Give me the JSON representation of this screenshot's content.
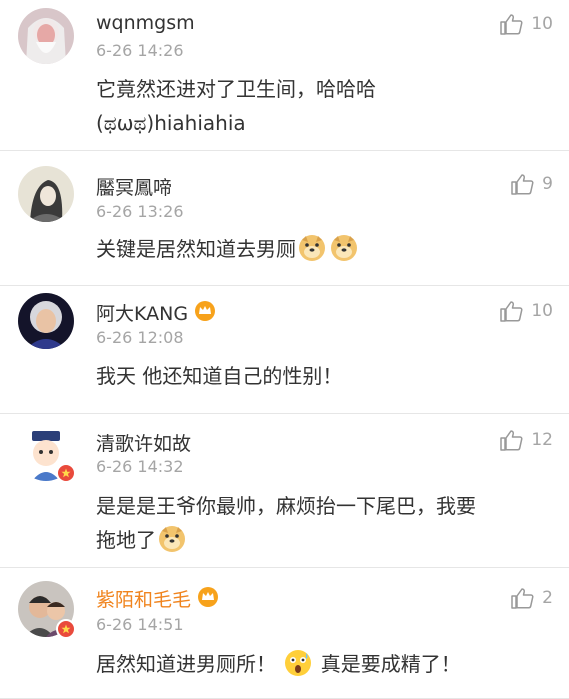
{
  "comments": [
    {
      "username": "wqnmgsm",
      "time": "6-26 14:26",
      "likes": "10",
      "text_line1": "它竟然还进对了卫生间，哈哈哈",
      "text_line2": "(ಥωಥ)hiahiahia",
      "avatar": "old-man-avatar"
    },
    {
      "username": "靨冥鳳啼",
      "time": "6-26 13:26",
      "likes": "9",
      "text": "关键是居然知道去男厕",
      "avatar": "ink-painting-girl-avatar"
    },
    {
      "username": "阿大KANG",
      "time": "6-26 12:08",
      "likes": "10",
      "text": "我天 他还知道自己的性别！",
      "avatar": "grandma-avatar"
    },
    {
      "username": "清歌许如故",
      "time": "6-26 14:32",
      "likes": "12",
      "text_line1": "是是是王爷你最帅，麻烦抬一下尾巴，我要",
      "text_line2": "拖地了",
      "avatar": "cartoon-qing-girl-avatar"
    },
    {
      "username": "紫陌和毛毛",
      "time": "6-26 14:51",
      "likes": "2",
      "text_part1": "居然知道进男厕所！",
      "text_part2": "真是要成精了！",
      "avatar": "couple-photo-avatar"
    }
  ],
  "colors": {
    "username": "#333333",
    "vip_username": "#f0841e",
    "meta": "#a5a5a5",
    "badge": "#e94a3c"
  }
}
